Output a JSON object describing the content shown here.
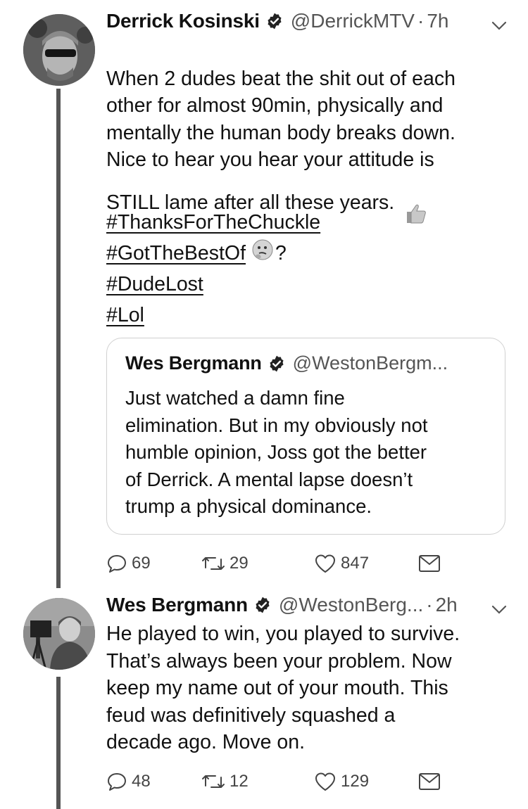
{
  "tweets": [
    {
      "name": "Derrick Kosinski",
      "handle": "@DerrickMTV",
      "dot": "·",
      "time": "7h",
      "text": "When 2 dudes beat the shit out of each\nother for almost 90min, physically and\nmentally the human body breaks down.\nNice to hear you hear your attitude is\nSTILL lame after all these years.",
      "hashtags": [
        "#ThanksForTheChuckle",
        "#GotTheBestOf",
        "#DudeLost",
        "#Lol"
      ],
      "hashtag_suffix": "?",
      "emojis": [
        "thumbs-up-emoji",
        "thinking-face-emoji"
      ],
      "quote": {
        "name": "Wes Bergmann",
        "handle": "@WestonBergm...",
        "text": "Just watched a damn fine\nelimination. But in my obviously not\nhumble opinion, Joss got the better\nof Derrick. A mental lapse doesn’t\ntrump a physical dominance."
      },
      "replies": "69",
      "retweets": "29",
      "likes": "847"
    },
    {
      "name": "Wes Bergmann",
      "handle": "@WestonBerg...",
      "dot": "·",
      "time": "2h",
      "text": "He played to win, you played to survive.\nThat’s always been your problem. Now\nkeep my name out of your mouth. This\nfeud was definitively squashed a\ndecade ago. Move on.",
      "replies": "48",
      "retweets": "12",
      "likes": "129"
    }
  ],
  "icons": [
    "verified-badge-icon",
    "chevron-down-icon",
    "reply-icon",
    "retweet-icon",
    "like-icon",
    "message-icon"
  ],
  "colors": {
    "text": "#111111",
    "muted": "#555555",
    "thread_line": "#555555",
    "border": "#d0d0d0"
  }
}
